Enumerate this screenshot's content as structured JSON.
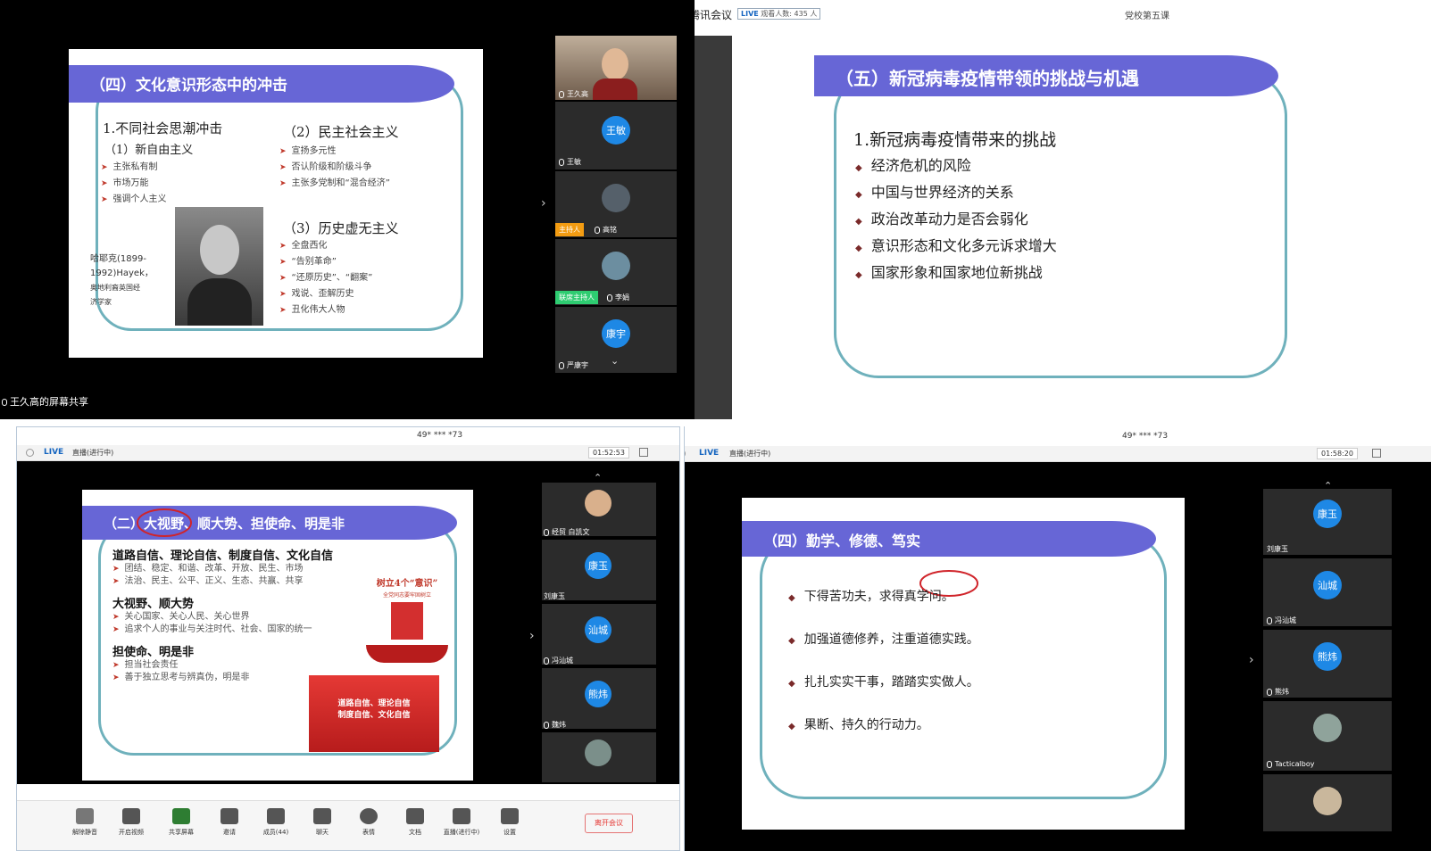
{
  "q1": {
    "slide_title": "（四）文化意识形态中的冲击",
    "left_heading": "1.不同社会思潮冲击",
    "left_sub": "（1）新自由主义",
    "left_items": [
      "主张私有制",
      "市场万能",
      "强调个人主义"
    ],
    "photo_caption_1": "哈耶克(1899-",
    "photo_caption_2": "1992)Hayek，",
    "photo_caption_3": "奥地利裔英国经",
    "photo_caption_4": "济学家",
    "right_sub_1": "（2）民主社会主义",
    "right_items_1": [
      "宣扬多元性",
      "否认阶级和阶级斗争",
      "主张多党制和“混合经济”"
    ],
    "right_sub_2": "（3）历史虚无主义",
    "right_items_2": [
      "全盘西化",
      "“告别革命”",
      "“还原历史”、“翻案”",
      "戏说、歪解历史",
      "丑化伟大人物"
    ],
    "participants": [
      "王久高",
      "王敏",
      "高铭",
      "李娟",
      "严康宇"
    ],
    "badge_host": "主持人",
    "badge_cohost": "联席主持人",
    "avatar_wangmin": "王敏",
    "avatar_kangyu": "康宇",
    "share_label": "王久高的屏幕共享"
  },
  "q2": {
    "app_name": "腾讯会议",
    "live_label": "LIVE",
    "viewers": "观看人数: 435 人",
    "meeting_title": "党校第五课",
    "slide_title": "（五）新冠病毒疫情带领的挑战与机遇",
    "heading": "1.新冠病毒疫情带来的挑战",
    "items": [
      "经济危机的风险",
      "中国与世界经济的关系",
      "政治改革动力是否会弱化",
      "意识形态和文化多元诉求增大",
      "国家形象和国家地位新挑战"
    ]
  },
  "q3": {
    "meeting_id": "49* *** *73",
    "live_label": "LIVE",
    "live_status": "直播(进行中)",
    "timer": "01:52:53",
    "slide_title": "（二）大视野、顺大势、担使命、明是非",
    "sections": [
      {
        "head": "道路自信、理论自信、制度自信、文化自信",
        "items": [
          "团结、稳定、和谐、改革、开放、民生、市场",
          "法治、民主、公平、正义、生态、共赢、共享"
        ]
      },
      {
        "head": "大视野、顺大势",
        "items": [
          "关心国家、关心人民、关心世界",
          "追求个人的事业与关注时代、社会、国家的统一"
        ]
      },
      {
        "head": "担使命、明是非",
        "items": [
          "担当社会责任",
          "善于独立思考与辨真伪，明是非"
        ]
      }
    ],
    "poster_title": "树立4个“意识”",
    "poster_sub": "全党同志要牢固树立",
    "poster2_line1": "道路自信、理论自信",
    "poster2_line2": "制度自信、文化自信",
    "participants": [
      "经贸 白凯文",
      "刘康玉",
      "冯汕城",
      "魏炜"
    ],
    "avatars": [
      "康玉",
      "汕城",
      "熊炜"
    ],
    "toolbar": [
      "解除静音",
      "开启视频",
      "共享屏幕",
      "邀请",
      "成员(44)",
      "聊天",
      "表情",
      "文档",
      "直播(进行中)",
      "设置"
    ],
    "leave_label": "离开会议"
  },
  "q4": {
    "meeting_id": "49* *** *73",
    "live_label": "LIVE",
    "live_status": "直播(进行中)",
    "timer": "01:58:20",
    "slide_title": "（四）勤学、修德、笃实",
    "items": [
      "下得苦功夫，求得真学问。",
      "加强道德修养，注重道德实践。",
      "扎扎实实干事，踏踏实实做人。",
      "果断、持久的行动力。"
    ],
    "participants": [
      "刘康玉",
      "冯汕城",
      "熊炜",
      "Tacticalboy"
    ],
    "avatars": [
      "康玉",
      "汕城",
      "熊炜"
    ]
  }
}
